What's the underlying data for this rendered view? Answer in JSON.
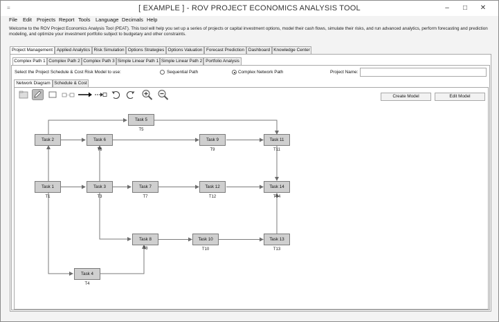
{
  "window": {
    "title": "[ EXAMPLE ] - ROV PROJECT ECONOMICS ANALYSIS TOOL",
    "minimize": "–",
    "maximize": "□",
    "close": "✕"
  },
  "menu": [
    "File",
    "Edit",
    "Projects",
    "Report",
    "Tools",
    "Language",
    "Decimals",
    "Help"
  ],
  "welcome": "Welcome to the ROV Project Economics Analysis Tool (PEAT). This tool will help you set up a series of projects or capital investment options, model their cash flows, simulate their risks, and run advanced analytics, perform forecasting and prediction modeling, and optimize your investment portfolio subject to budgetary and other constraints.",
  "main_tabs": [
    "Project Management",
    "Applied Analytics",
    "Risk Simulation",
    "Options Strategies",
    "Options Valuation",
    "Forecast Prediction",
    "Dashboard",
    "Knowledge Center"
  ],
  "path_tabs": [
    "Complex Path 1",
    "Complex Path 2",
    "Complex Path 3",
    "Simple Linear Path 1",
    "Simple Linear Path 2",
    "Portfolio Analysis"
  ],
  "model_select": {
    "label": "Select the Project Schedule & Cost Risk Model to use:",
    "option_sequential": "Sequential Path",
    "option_network": "Complex Network Path",
    "selected": "Complex Network Path",
    "project_name_label": "Project Name:",
    "project_name_value": ""
  },
  "sub_tabs": [
    "Network Diagram",
    "Schedule & Cost"
  ],
  "buttons": {
    "create_model": "Create Model",
    "edit_model": "Edit Model"
  },
  "toolbar_icons": [
    "open-icon",
    "edit-pencil-icon",
    "rectangle-icon",
    "node-link-icon",
    "arrow-line-icon",
    "dashed-arrow-icon",
    "undo-icon",
    "redo-icon",
    "zoom-in-icon",
    "zoom-out-icon"
  ],
  "nodes": [
    {
      "label": "Task 1",
      "caption": "T1"
    },
    {
      "label": "Task 2",
      "caption": ""
    },
    {
      "label": "Task 3",
      "caption": "T3"
    },
    {
      "label": "Task 4",
      "caption": "T4"
    },
    {
      "label": "Task 5",
      "caption": "T5"
    },
    {
      "label": "Task 6",
      "caption": "T6"
    },
    {
      "label": "Task 7",
      "caption": "T7"
    },
    {
      "label": "Task 8",
      "caption": "T8"
    },
    {
      "label": "Task 9",
      "caption": "T9"
    },
    {
      "label": "Task 10",
      "caption": "T10"
    },
    {
      "label": "Task 11",
      "caption": "T11"
    },
    {
      "label": "Task 12",
      "caption": "T12"
    },
    {
      "label": "Task 13",
      "caption": "T13"
    },
    {
      "label": "Task 14",
      "caption": "T14"
    }
  ]
}
